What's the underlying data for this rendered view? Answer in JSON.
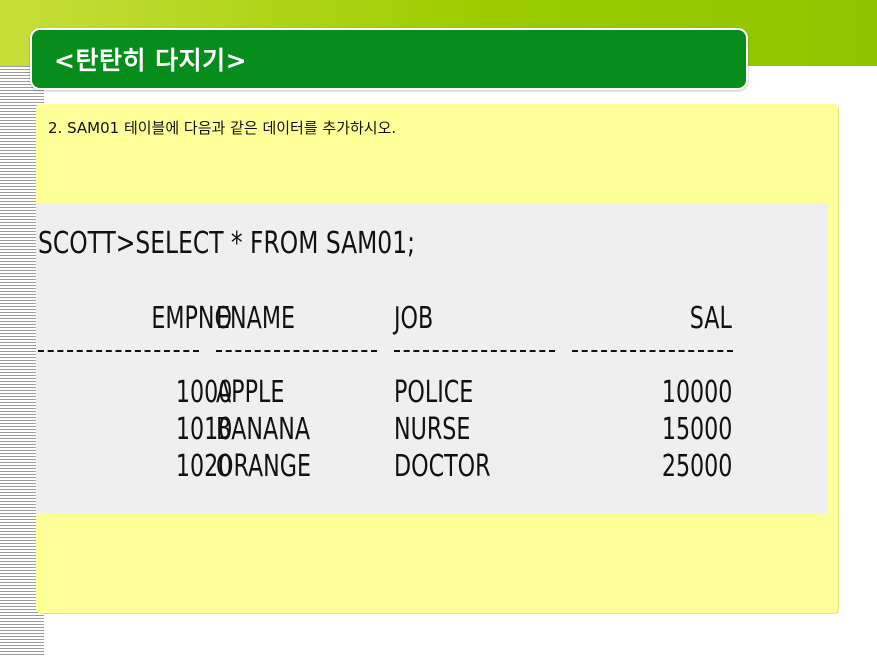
{
  "slide": {
    "title": "<탄탄히 다지기>",
    "question": "2. SAM01 테이블에 다음과 같은 데이터를 추가하시오."
  },
  "query": {
    "command": "SCOTT>SELECT * FROM SAM01;",
    "columns": [
      "EMPNO",
      "ENAME",
      "JOB",
      "SAL"
    ],
    "separator": "----------",
    "rows": [
      [
        "1000",
        "APPLE",
        "POLICE",
        "10000"
      ],
      [
        "1010",
        "BANANA",
        "NURSE",
        "15000"
      ],
      [
        "1020",
        "ORANGE",
        "DOCTOR",
        "25000"
      ]
    ]
  },
  "colors": {
    "title_bar": "#078d1c",
    "top_band": "#9ccc00",
    "panel": "#ffff99",
    "query_block": "#efefef"
  }
}
